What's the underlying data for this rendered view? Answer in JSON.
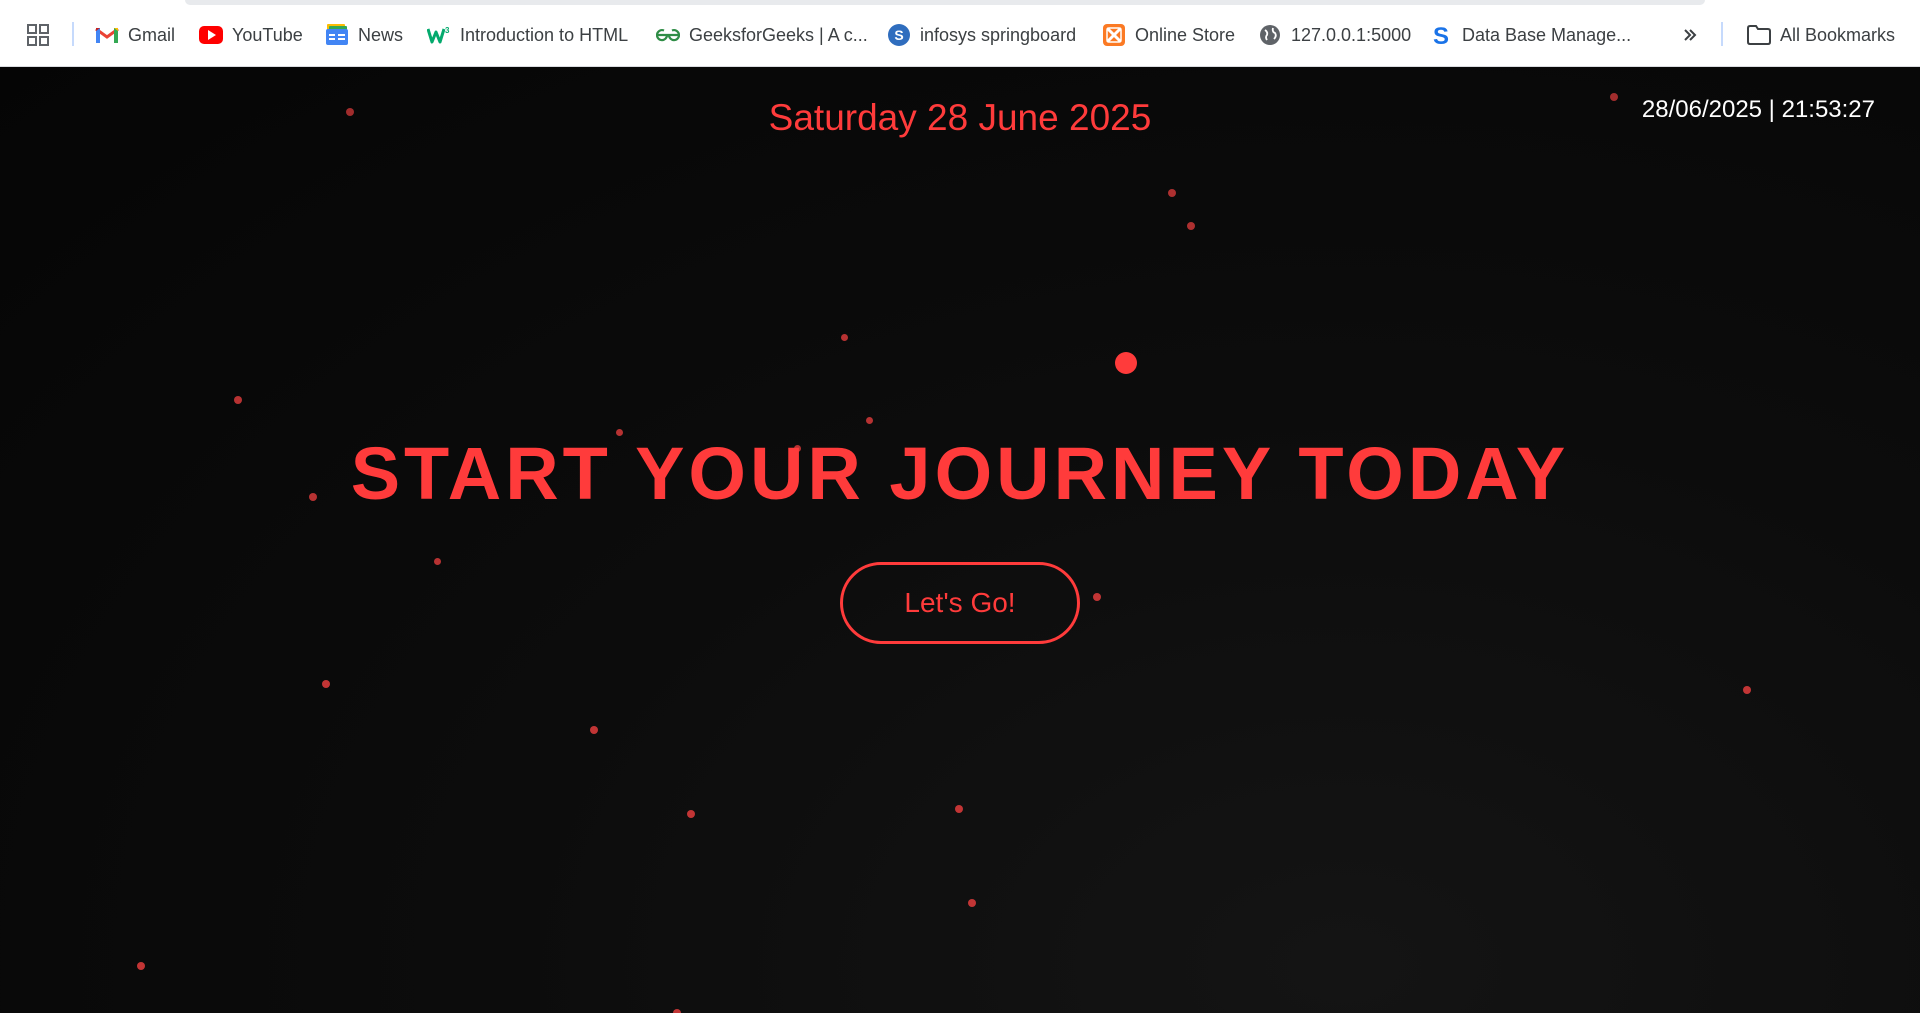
{
  "bookmarks": {
    "items": [
      {
        "label": "Gmail",
        "icon": "gmail-icon"
      },
      {
        "label": "YouTube",
        "icon": "youtube-icon"
      },
      {
        "label": "News",
        "icon": "google-news-icon"
      },
      {
        "label": "Introduction to HTML",
        "icon": "w3schools-icon"
      },
      {
        "label": "GeeksforGeeks | A c...",
        "icon": "geeksforgeeks-icon"
      },
      {
        "label": "infosys springboard",
        "icon": "springboard-icon"
      },
      {
        "label": "Online Store",
        "icon": "xampp-icon"
      },
      {
        "label": "127.0.0.1:5000",
        "icon": "globe-icon"
      },
      {
        "label": "Data Base Manage...",
        "icon": "skype-s-icon"
      }
    ],
    "all_bookmarks_label": "All Bookmarks"
  },
  "hero": {
    "date": "Saturday 28 June 2025",
    "clock": "28/06/2025 | 21:53:27",
    "headline": "START YOUR JOURNEY TODAY",
    "cta_label": "Let's Go!"
  },
  "colors": {
    "accent": "#ff3b3b",
    "background": "#0a0a0a",
    "particle": "#d63a3a",
    "clock_text": "#ffffff"
  }
}
